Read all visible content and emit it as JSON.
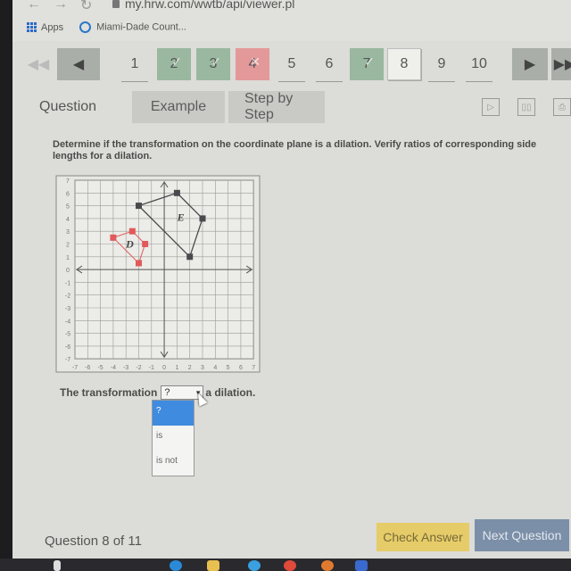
{
  "browser": {
    "url": "my.hrw.com/wwtb/api/viewer.pl",
    "bookmarks": [
      {
        "label": "Apps",
        "icon": "apps-grid-icon"
      },
      {
        "label": "Miami-Dade Count...",
        "icon": "globe-icon"
      }
    ]
  },
  "question_nav": {
    "first_icon": "double-left-arrow-icon",
    "prev_icon": "left-arrow-icon",
    "next_icon": "right-arrow-icon",
    "last_icon": "double-right-arrow-icon",
    "items": [
      {
        "label": "1",
        "status": "unanswered"
      },
      {
        "label": "2",
        "status": "correct"
      },
      {
        "label": "3",
        "status": "correct"
      },
      {
        "label": "4",
        "status": "incorrect"
      },
      {
        "label": "5",
        "status": "unanswered"
      },
      {
        "label": "6",
        "status": "unanswered"
      },
      {
        "label": "7",
        "status": "correct"
      },
      {
        "label": "8",
        "status": "current"
      },
      {
        "label": "9",
        "status": "unanswered"
      },
      {
        "label": "10",
        "status": "unanswered"
      }
    ],
    "check_mark": "✓",
    "x_mark": "✕"
  },
  "tabs": [
    {
      "label": "Question",
      "active": true
    },
    {
      "label": "Example",
      "active": false
    },
    {
      "label": "Step by Step",
      "active": false
    }
  ],
  "tool_icons": [
    "video-play-icon",
    "book-icon",
    "print-icon"
  ],
  "prompt": "Determine if the transformation on the coordinate plane is a dilation. Verify ratios of corresponding side lengths for a dilation.",
  "graph": {
    "x_range": [
      -7,
      7
    ],
    "y_range": [
      -7,
      7
    ],
    "x_ticks": [
      "-7",
      "-6",
      "-5",
      "-4",
      "-3",
      "-2",
      "-1",
      "0",
      "1",
      "2",
      "3",
      "4",
      "5",
      "6",
      "7"
    ],
    "y_ticks": [
      "7",
      "6",
      "5",
      "4",
      "3",
      "2",
      "1",
      "0",
      "-1",
      "-2",
      "-3",
      "-4",
      "-5",
      "-6",
      "-7"
    ],
    "figures": [
      {
        "name": "E",
        "color": "#4a4a4e",
        "points": [
          [
            -2,
            5
          ],
          [
            1,
            6
          ],
          [
            3,
            4
          ],
          [
            2,
            1
          ]
        ],
        "label_at": [
          1.3,
          4.1
        ]
      },
      {
        "name": "D",
        "color": "#e05a5a",
        "points": [
          [
            -4,
            2.5
          ],
          [
            -2.5,
            3
          ],
          [
            -1.5,
            2
          ],
          [
            -2,
            0.5
          ]
        ],
        "label_at": [
          -2.7,
          2.0
        ]
      }
    ]
  },
  "answer": {
    "prefix": "The transformation",
    "selected": "?",
    "suffix": "a dilation.",
    "options": [
      "?",
      "is",
      "is not"
    ],
    "highlighted_index": 0
  },
  "footer": {
    "question_count": "Question 8 of 11",
    "check_answer": "Check Answer",
    "next_question": "Next Question"
  },
  "colors": {
    "correct": "#99b89f",
    "incorrect": "#e3999a",
    "check_button": "#e6cc68",
    "next_button": "#7b8fa8",
    "dropdown_highlight": "#3f8be0"
  }
}
